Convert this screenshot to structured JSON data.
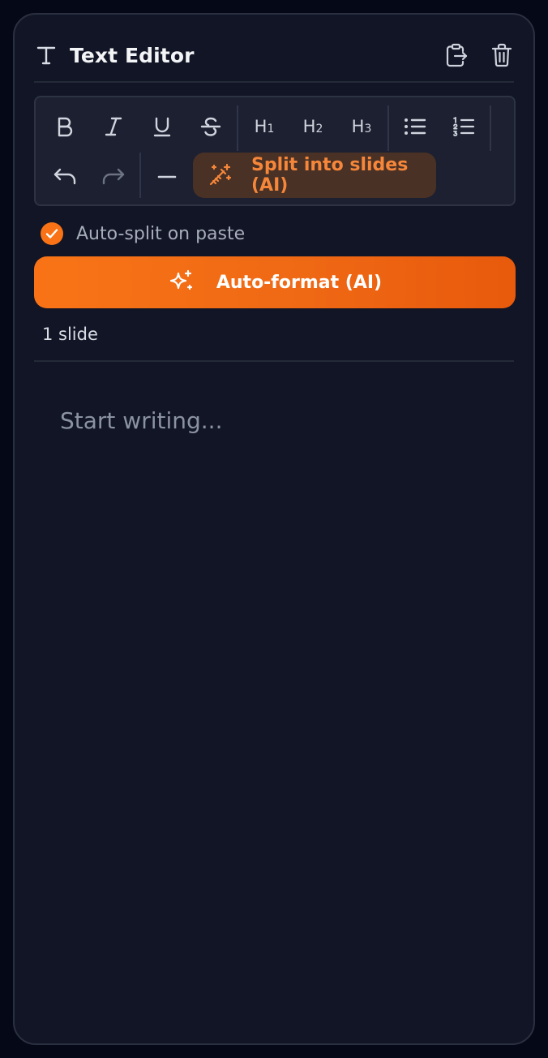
{
  "header": {
    "title": "Text Editor",
    "icon": "text-t-icon",
    "actions": [
      {
        "name": "export-icon"
      },
      {
        "name": "trash-icon"
      }
    ]
  },
  "toolbar": {
    "buttons": [
      "bold-icon",
      "italic-icon",
      "underline-icon",
      "strikethrough-icon",
      "h1",
      "h2",
      "h3",
      "bullet-list-icon",
      "numbered-list-icon",
      "undo-icon",
      "redo-icon",
      "horizontal-rule-icon"
    ],
    "headings": {
      "h": "H",
      "h1": "1",
      "h2": "2",
      "h3": "3"
    },
    "split_label": "Split into slides (AI)"
  },
  "auto_split": {
    "label": "Auto-split on paste",
    "checked": true
  },
  "auto_format": {
    "label": "Auto-format (AI)"
  },
  "slide_count": "1 slide",
  "editor": {
    "placeholder": "Start writing..."
  },
  "colors": {
    "accent": "#f97316",
    "panel_bg": "#111525",
    "page_bg": "#050816",
    "toolbar_bg": "#1c2030"
  }
}
